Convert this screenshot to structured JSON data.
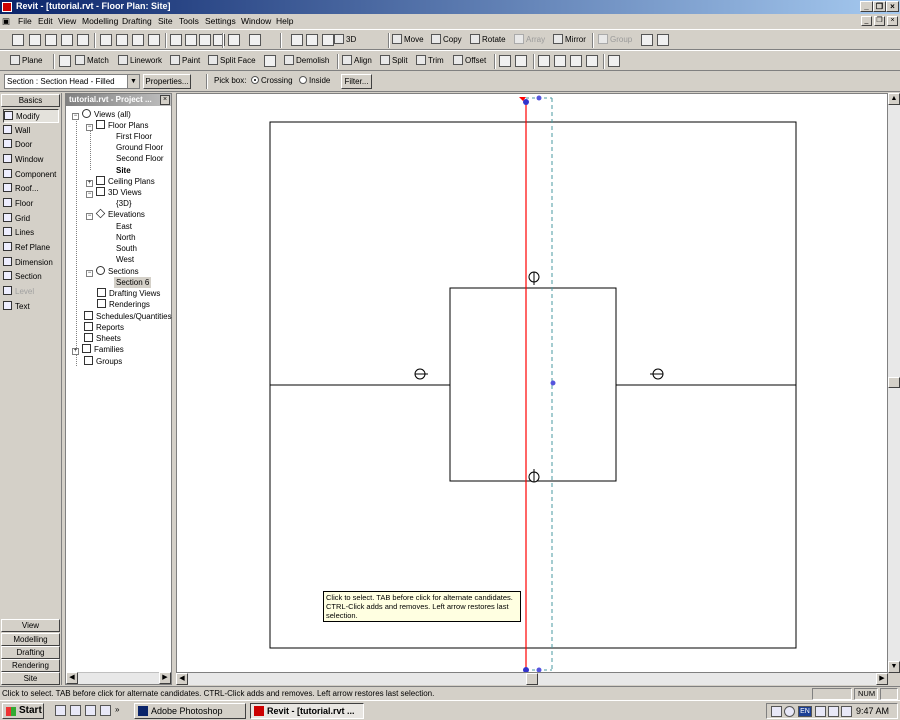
{
  "window": {
    "title": "Revit - [tutorial.rvt - Floor Plan: Site]"
  },
  "menu": [
    "File",
    "Edit",
    "View",
    "Modelling",
    "Drafting",
    "Site",
    "Tools",
    "Settings",
    "Window",
    "Help"
  ],
  "toolbar1": {
    "view_3d": "3D",
    "move": "Move",
    "copy": "Copy",
    "rotate": "Rotate",
    "array": "Array",
    "mirror": "Mirror",
    "group": "Group"
  },
  "toolbar2": {
    "plane": "Plane",
    "match": "Match",
    "linework": "Linework",
    "paint": "Paint",
    "split_face": "Split Face",
    "demolish": "Demolish",
    "align": "Align",
    "split": "Split",
    "trim": "Trim",
    "offset": "Offset"
  },
  "options_bar": {
    "type_selector": "Section : Section Head - Filled",
    "properties": "Properties...",
    "pick_box": "Pick box:",
    "crossing": "Crossing",
    "inside": "Inside",
    "filter": "Filter..."
  },
  "design_bar": {
    "active_tab": "Basics",
    "items": [
      "Modify",
      "Wall",
      "Door",
      "Window",
      "Component",
      "Roof...",
      "Floor",
      "Grid",
      "Lines",
      "Ref Plane",
      "Dimension",
      "Section",
      "Level",
      "Text"
    ],
    "bottom_tabs": [
      "View",
      "Modelling",
      "Drafting",
      "Rendering",
      "Site"
    ]
  },
  "project_browser": {
    "title": "tutorial.rvt - Project ...",
    "views_all": "Views (all)",
    "floor_plans": "Floor Plans",
    "floor_plan_items": [
      "First Floor",
      "Ground Floor",
      "Second Floor",
      "Site"
    ],
    "ceiling_plans": "Ceiling Plans",
    "views_3d": "3D Views",
    "views_3d_items": [
      "{3D}"
    ],
    "elevations": "Elevations",
    "elevation_items": [
      "East",
      "North",
      "South",
      "West"
    ],
    "sections": "Sections",
    "section_items": [
      "Section 6"
    ],
    "drafting_views": "Drafting Views",
    "renderings": "Renderings",
    "schedules": "Schedules/Quantities",
    "reports": "Reports",
    "sheets": "Sheets",
    "families": "Families",
    "groups": "Groups"
  },
  "tooltip": "Click to select. TAB before click for alternate candidates. CTRL-Click adds and removes. Left arrow restores last selection.",
  "status": {
    "text": "Click to select. TAB before click for alternate candidates. CTRL-Click adds and removes. Left arrow restores last selection.",
    "num": "NUM"
  },
  "taskbar": {
    "start": "Start",
    "tasks": [
      "Adobe Photoshop",
      "Revit - [tutorial.rvt ..."
    ],
    "lang": "EN",
    "clock": "9:47 AM"
  },
  "colors": {
    "section_line": "#ff0000",
    "grip": "#3333cc",
    "crop_dashed": "#4a9aa0"
  }
}
